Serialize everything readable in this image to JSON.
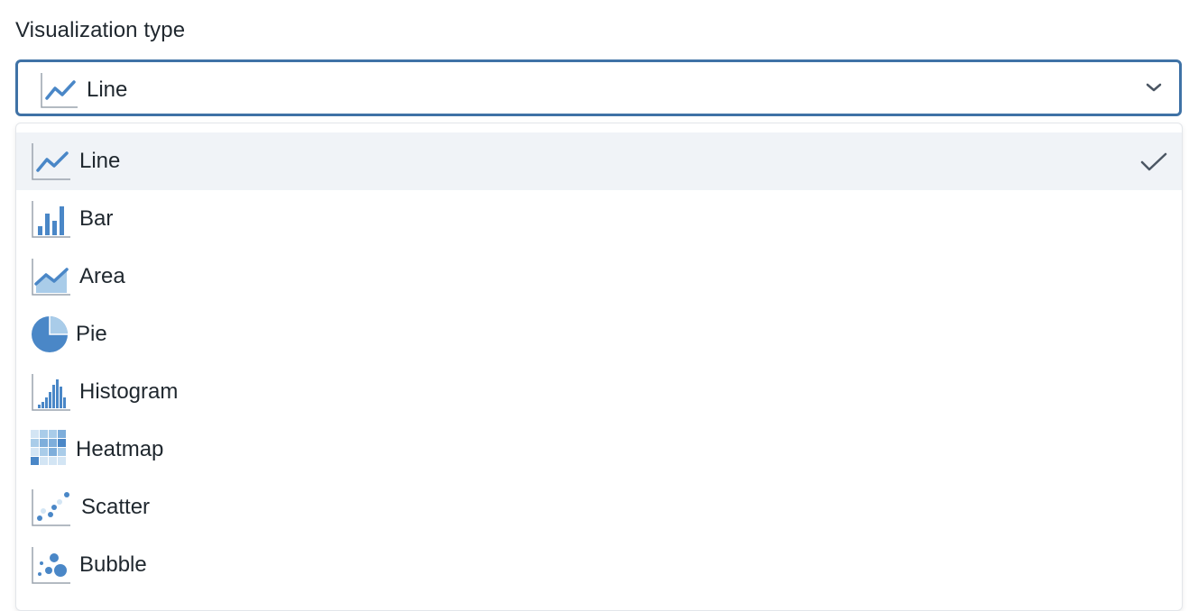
{
  "field": {
    "label": "Visualization type"
  },
  "select": {
    "value": "Line",
    "icon": "line-chart-icon"
  },
  "colors": {
    "accent": "#4a87c7",
    "accent_light": "#a9cce9",
    "focus_border": "#3f72a6",
    "selected_bg": "#f0f3f7"
  },
  "options": [
    {
      "label": "Line",
      "icon": "line-chart-icon",
      "selected": true
    },
    {
      "label": "Bar",
      "icon": "bar-chart-icon",
      "selected": false
    },
    {
      "label": "Area",
      "icon": "area-chart-icon",
      "selected": false
    },
    {
      "label": "Pie",
      "icon": "pie-chart-icon",
      "selected": false
    },
    {
      "label": "Histogram",
      "icon": "histogram-chart-icon",
      "selected": false
    },
    {
      "label": "Heatmap",
      "icon": "heatmap-chart-icon",
      "selected": false
    },
    {
      "label": "Scatter",
      "icon": "scatter-chart-icon",
      "selected": false
    },
    {
      "label": "Bubble",
      "icon": "bubble-chart-icon",
      "selected": false
    }
  ]
}
